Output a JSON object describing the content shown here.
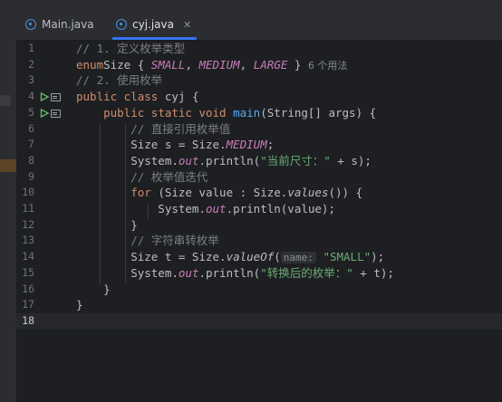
{
  "tabs": [
    {
      "label": "Main.java",
      "active": false
    },
    {
      "label": "cyj.java",
      "active": true,
      "close_icon": "close-icon"
    }
  ],
  "colors": {
    "background": "#1e1f22",
    "keyword": "#cf8e6d",
    "function": "#56a8f5",
    "string": "#6aab73",
    "comment": "#7a7e85",
    "enum_constant": "#c77dbb",
    "accent": "#3574f0"
  },
  "current_line": 18,
  "lines": [
    {
      "n": "1",
      "tokens": [
        [
          "cmt",
          "// 1. 定义枚举类型"
        ]
      ]
    },
    {
      "n": "2",
      "tokens": [
        [
          "kw",
          "enum"
        ],
        [
          "",
          "Size { "
        ],
        [
          "en",
          "SMALL"
        ],
        [
          "",
          ", "
        ],
        [
          "en",
          "MEDIUM"
        ],
        [
          "",
          ", "
        ],
        [
          "en",
          "LARGE"
        ],
        [
          "",
          " } "
        ],
        [
          "hint",
          "6 个用法"
        ]
      ]
    },
    {
      "n": "3",
      "tokens": [
        [
          "cmt",
          "// 2. 使用枚举"
        ]
      ]
    },
    {
      "n": "4",
      "run": true,
      "tokens": [
        [
          "kw",
          "public class"
        ],
        [
          "",
          " cyj {"
        ]
      ]
    },
    {
      "n": "5",
      "run": true,
      "tokens": [
        [
          "",
          "    "
        ],
        [
          "kw",
          "public static void"
        ],
        [
          "",
          " "
        ],
        [
          "fn",
          "main"
        ],
        [
          "",
          "(String[] args) {"
        ]
      ]
    },
    {
      "n": "6",
      "tokens": [
        [
          "",
          "        "
        ],
        [
          "cmt",
          "// 直接引用枚举值"
        ]
      ]
    },
    {
      "n": "7",
      "tokens": [
        [
          "",
          "        Size s = Size."
        ],
        [
          "en",
          "MEDIUM"
        ],
        [
          "",
          ";"
        ]
      ]
    },
    {
      "n": "8",
      "tokens": [
        [
          "",
          "        System."
        ],
        [
          "st",
          "out"
        ],
        [
          "",
          ".println("
        ],
        [
          "str",
          "\"当前尺寸：\""
        ],
        [
          "",
          " + s);"
        ]
      ]
    },
    {
      "n": "9",
      "tokens": [
        [
          "",
          "        "
        ],
        [
          "cmt",
          "// 枚举值迭代"
        ]
      ]
    },
    {
      "n": "10",
      "tokens": [
        [
          "",
          "        "
        ],
        [
          "kw",
          "for"
        ],
        [
          "",
          " (Size value : Size."
        ],
        [
          "itm",
          "values"
        ],
        [
          "",
          "()) {"
        ]
      ]
    },
    {
      "n": "11",
      "tokens": [
        [
          "",
          "            System."
        ],
        [
          "st",
          "out"
        ],
        [
          "",
          ".println(value);"
        ]
      ]
    },
    {
      "n": "12",
      "tokens": [
        [
          "",
          "        }"
        ]
      ]
    },
    {
      "n": "13",
      "tokens": [
        [
          "",
          "        "
        ],
        [
          "cmt",
          "// 字符串转枚举"
        ]
      ]
    },
    {
      "n": "14",
      "tokens": [
        [
          "",
          "        Size t = Size."
        ],
        [
          "itm",
          "valueOf"
        ],
        [
          "",
          "("
        ],
        [
          "hintbox",
          "name:"
        ],
        [
          "str",
          " \"SMALL\""
        ],
        [
          "",
          ");"
        ]
      ]
    },
    {
      "n": "15",
      "tokens": [
        [
          "",
          "        System."
        ],
        [
          "st",
          "out"
        ],
        [
          "",
          ".println("
        ],
        [
          "str",
          "\"转换后的枚举：\""
        ],
        [
          "",
          " + t);"
        ]
      ]
    },
    {
      "n": "16",
      "tokens": [
        [
          "",
          "    }"
        ]
      ]
    },
    {
      "n": "17",
      "tokens": [
        [
          "",
          "}"
        ]
      ]
    },
    {
      "n": "18",
      "tokens": []
    }
  ]
}
